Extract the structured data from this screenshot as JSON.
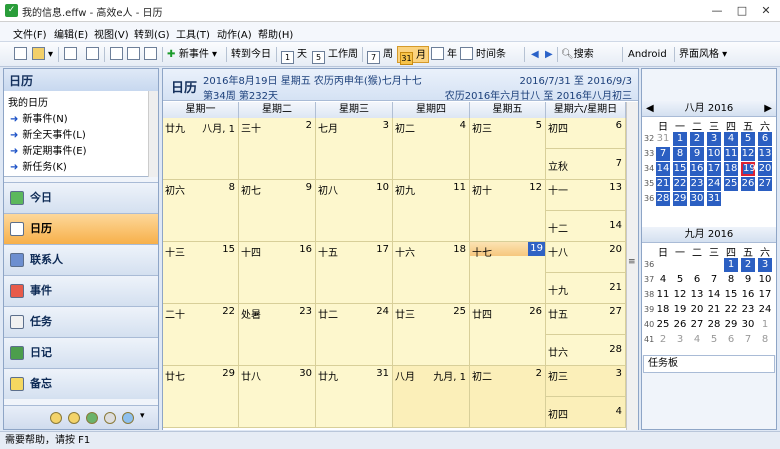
{
  "window": {
    "title": "我的信息.effw - 高效e人 - 日历",
    "minimize": "—",
    "maximize": "□",
    "close": "✕"
  },
  "menu": [
    "文件(F)",
    "编辑(E)",
    "视图(V)",
    "转到(G)",
    "工具(T)",
    "动作(A)",
    "帮助(H)"
  ],
  "toolbar": {
    "new_event": "新事件",
    "goto_today": "转到今日",
    "day": "天",
    "workweek": "工作周",
    "week": "周",
    "month": "月",
    "year": "年",
    "timeline": "时间条",
    "search": "搜索",
    "android": "Android",
    "style": "界面风格",
    "day_num": "1",
    "workweek_num": "5",
    "week_num": "7",
    "month_num": "31"
  },
  "left": {
    "title": "日历",
    "section": "我的日历",
    "items": [
      "新事件(N)",
      "新全天事件(L)",
      "新定期事件(E)",
      "新任务(K)"
    ],
    "nav": [
      "今日",
      "日历",
      "联系人",
      "事件",
      "任务",
      "日记",
      "备忘"
    ]
  },
  "main": {
    "title": "日历",
    "line1": "2016年8月19日 星期五 农历丙申年(猴)七月十七",
    "line2": "第34周 第232天",
    "range": "2016/7/31 至 2016/9/3",
    "lunar_range": "农历2016年六月廿八 至 2016年八月初三",
    "weekdays": [
      "星期一",
      "星期二",
      "星期三",
      "星期四",
      "星期五",
      "星期六/星期日"
    ],
    "weeks": [
      [
        {
          "l": "廿九",
          "d": "八月, 1"
        },
        {
          "l": "三十",
          "d": "2"
        },
        {
          "l": "七月",
          "d": "3"
        },
        {
          "l": "初二",
          "d": "4"
        },
        {
          "l": "初三",
          "d": "5"
        },
        {
          "l": "初四",
          "d": "6"
        },
        {
          "l": "立秋",
          "d": "7"
        }
      ],
      [
        {
          "l": "初六",
          "d": "8"
        },
        {
          "l": "初七",
          "d": "9"
        },
        {
          "l": "初八",
          "d": "10"
        },
        {
          "l": "初九",
          "d": "11"
        },
        {
          "l": "初十",
          "d": "12"
        },
        {
          "l": "十一",
          "d": "13"
        },
        {
          "l": "十二",
          "d": "14"
        }
      ],
      [
        {
          "l": "十三",
          "d": "15"
        },
        {
          "l": "十四",
          "d": "16"
        },
        {
          "l": "十五",
          "d": "17"
        },
        {
          "l": "十六",
          "d": "18"
        },
        {
          "l": "十七",
          "d": "19"
        },
        {
          "l": "十八",
          "d": "20"
        },
        {
          "l": "十九",
          "d": "21"
        }
      ],
      [
        {
          "l": "二十",
          "d": "22"
        },
        {
          "l": "处暑",
          "d": "23"
        },
        {
          "l": "廿二",
          "d": "24"
        },
        {
          "l": "廿三",
          "d": "25"
        },
        {
          "l": "廿四",
          "d": "26"
        },
        {
          "l": "廿五",
          "d": "27"
        },
        {
          "l": "廿六",
          "d": "28"
        }
      ],
      [
        {
          "l": "廿七",
          "d": "29"
        },
        {
          "l": "廿八",
          "d": "30"
        },
        {
          "l": "廿九",
          "d": "31"
        },
        {
          "l": "八月",
          "d": "九月, 1"
        },
        {
          "l": "初二",
          "d": "2"
        },
        {
          "l": "初三",
          "d": "3"
        },
        {
          "l": "初四",
          "d": "4"
        }
      ]
    ]
  },
  "mini_aug": {
    "title": "八月 2016",
    "prev": "◀",
    "next": "▶",
    "dow": [
      "日",
      "一",
      "二",
      "三",
      "四",
      "五",
      "六"
    ],
    "weeks": [
      "32",
      "33",
      "34",
      "35",
      "36"
    ],
    "rows": [
      [
        "31",
        "1",
        "2",
        "3",
        "4",
        "5",
        "6"
      ],
      [
        "7",
        "8",
        "9",
        "10",
        "11",
        "12",
        "13"
      ],
      [
        "14",
        "15",
        "16",
        "17",
        "18",
        "19",
        "20"
      ],
      [
        "21",
        "22",
        "23",
        "24",
        "25",
        "26",
        "27"
      ],
      [
        "28",
        "29",
        "30",
        "31",
        "",
        "",
        ""
      ]
    ]
  },
  "mini_sep": {
    "title": "九月 2016",
    "dow": [
      "日",
      "一",
      "二",
      "三",
      "四",
      "五",
      "六"
    ],
    "weeks": [
      "36",
      "37",
      "38",
      "39",
      "40",
      "41"
    ],
    "rows": [
      [
        "",
        "",
        "",
        "",
        "1",
        "2",
        "3"
      ],
      [
        "4",
        "5",
        "6",
        "7",
        "8",
        "9",
        "10"
      ],
      [
        "11",
        "12",
        "13",
        "14",
        "15",
        "16",
        "17"
      ],
      [
        "18",
        "19",
        "20",
        "21",
        "22",
        "23",
        "24"
      ],
      [
        "25",
        "26",
        "27",
        "28",
        "29",
        "30",
        "1"
      ],
      [
        "2",
        "3",
        "4",
        "5",
        "6",
        "7",
        "8"
      ]
    ]
  },
  "taskboard": "任务板",
  "status": "需要帮助，请按 F1"
}
